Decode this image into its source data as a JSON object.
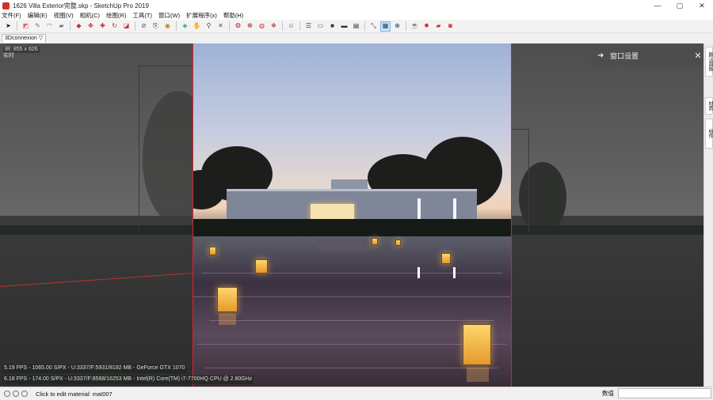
{
  "window": {
    "title": "1626 Villa Exterior完整.skp - SketchUp Pro 2019",
    "minimize": "—",
    "maximize": "▢",
    "close": "✕"
  },
  "menus": [
    "文件(F)",
    "编辑(E)",
    "视图(V)",
    "相机(C)",
    "绘图(R)",
    "工具(T)",
    "窗口(W)",
    "扩展程序(x)",
    "帮助(H)"
  ],
  "toolbar": {
    "icons": [
      "select-icon",
      "eraser-icon",
      "pencil-icon",
      "arc-icon",
      "shape-icon",
      "push-pull-icon",
      "move-icon",
      "rotate-icon",
      "scale-icon",
      "offset-icon",
      "tape-icon",
      "text-icon",
      "axes-icon",
      "paint-icon",
      "orbit-icon",
      "pan-icon",
      "zoom-icon",
      "zoom-extents-icon",
      "warehouse-icon",
      "extension-icon",
      "ruby-icon",
      "component-icon",
      "user-icon",
      "section-icon",
      "section-fill-icon",
      "sandbox-icon",
      "grid-icon",
      "layer-icon",
      "walk-icon",
      "vray-render-icon",
      "vray-settings-icon",
      "vray-frame-icon",
      "vray-interactive-icon"
    ]
  },
  "scene_tab": "3Dconnexion ▽",
  "viewport": {
    "resolution": "IR: 855 x 626",
    "resolution_sub": "实时",
    "perf_line1": "5.19 FPS - 1065.00 S/PX - U:3337/F:5931/8192 MB - GeForce GTX 1070",
    "perf_line2": "6.18 FPS - 174.00 S/PX - U:3337/F:8568/16253 MB - Intel(R) Core(TM) i7-7700HQ CPU @ 2.80GHz"
  },
  "panel": {
    "arrow": "➜",
    "title": "窗口设置",
    "close": "✕"
  },
  "dock_tabs": [
    "默认面板",
    "材质",
    "组件"
  ],
  "status": {
    "message": "Click to edit material: mat007",
    "measure_label": "数值",
    "measure_value": ""
  }
}
